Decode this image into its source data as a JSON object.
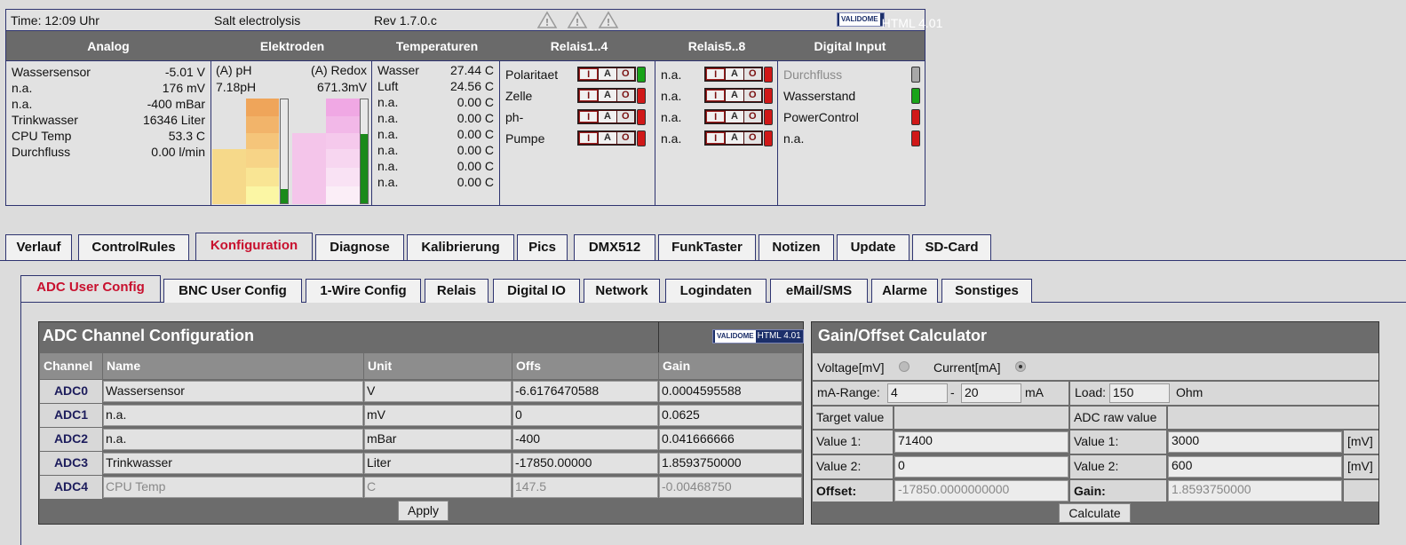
{
  "status": {
    "time": "Time: 12:09 Uhr",
    "title": "Salt electrolysis",
    "rev": "Rev 1.7.0.c",
    "validator": {
      "badge": "VALIDOME",
      "label": "HTML 4.01"
    },
    "headers": [
      "Analog",
      "Elektroden",
      "Temperaturen",
      "Relais1..4",
      "Relais5..8",
      "Digital Input"
    ],
    "analog": [
      {
        "name": "Wassersensor",
        "value": "-5.01 V"
      },
      {
        "name": "n.a.",
        "value": "176 mV"
      },
      {
        "name": "n.a.",
        "value": "-400 mBar"
      },
      {
        "name": "Trinkwasser",
        "value": "16346 Liter"
      },
      {
        "name": "CPU Temp",
        "value": "53.3 C"
      },
      {
        "name": "Durchfluss",
        "value": "0.00 l/min"
      }
    ],
    "electrodes": {
      "ph_label": "(A) pH",
      "redox_label": "(A) Redox",
      "ph_value": "7.18pH",
      "redox_value": "671.3mV",
      "ph_level": 0.14,
      "redox_level": 0.67
    },
    "temperatures": [
      {
        "name": "Wasser",
        "value": "27.44 C"
      },
      {
        "name": "Luft",
        "value": "24.56 C"
      },
      {
        "name": "n.a.",
        "value": "0.00 C"
      },
      {
        "name": "n.a.",
        "value": "0.00 C"
      },
      {
        "name": "n.a.",
        "value": "0.00 C"
      },
      {
        "name": "n.a.",
        "value": "0.00 C"
      },
      {
        "name": "n.a.",
        "value": "0.00 C"
      },
      {
        "name": "n.a.",
        "value": "0.00 C"
      }
    ],
    "relais1": [
      {
        "name": "Polaritaet",
        "state": "green"
      },
      {
        "name": "Zelle",
        "state": "red"
      },
      {
        "name": "ph-",
        "state": "red"
      },
      {
        "name": "Pumpe",
        "state": "red"
      }
    ],
    "relais2": [
      {
        "name": "n.a.",
        "state": "red"
      },
      {
        "name": "n.a.",
        "state": "red"
      },
      {
        "name": "n.a.",
        "state": "red"
      },
      {
        "name": "n.a.",
        "state": "red"
      }
    ],
    "relay_buttons": {
      "i": "I",
      "a": "A",
      "o": "O"
    },
    "digital": [
      {
        "name": "Durchfluss",
        "state": "grey"
      },
      {
        "name": "Wasserstand",
        "state": "green"
      },
      {
        "name": "PowerControl",
        "state": "red"
      },
      {
        "name": "n.a.",
        "state": "red"
      }
    ],
    "colors": {
      "border": "#2e3470",
      "header": "#6a6a6a",
      "active_tab": "#c8102e"
    }
  },
  "tabs": [
    "Verlauf",
    "ControlRules",
    "Konfiguration",
    "Diagnose",
    "Kalibrierung",
    "Pics",
    "DMX512",
    "FunkTaster",
    "Notizen",
    "Update",
    "SD-Card"
  ],
  "active_tab": "Konfiguration",
  "subtabs": [
    "ADC User Config",
    "BNC User Config",
    "1-Wire Config",
    "Relais",
    "Digital IO",
    "Network",
    "Logindaten",
    "eMail/SMS",
    "Alarme",
    "Sonstiges"
  ],
  "active_subtab": "ADC User Config",
  "adc": {
    "title": "ADC Channel Configuration",
    "columns": [
      "Channel",
      "Name",
      "Unit",
      "Offs",
      "Gain"
    ],
    "rows": [
      {
        "channel": "ADC0",
        "name": "Wassersensor",
        "unit": "V",
        "offs": "-6.6176470588",
        "gain": "0.0004595588"
      },
      {
        "channel": "ADC1",
        "name": "n.a.",
        "unit": "mV",
        "offs": "0",
        "gain": "0.0625"
      },
      {
        "channel": "ADC2",
        "name": "n.a.",
        "unit": "mBar",
        "offs": "-400",
        "gain": "0.041666666"
      },
      {
        "channel": "ADC3",
        "name": "Trinkwasser",
        "unit": "Liter",
        "offs": "-17850.00000",
        "gain": "1.8593750000"
      },
      {
        "channel": "ADC4",
        "name": "CPU Temp",
        "unit": "C",
        "offs": "147.5",
        "gain": "-0.00468750"
      }
    ],
    "apply_label": "Apply"
  },
  "calc": {
    "title": "Gain/Offset Calculator",
    "voltage_label": "Voltage[mV]",
    "current_label": "Current[mA]",
    "ma_range_label": "mA-Range:",
    "ma_from": "4",
    "dash": "-",
    "ma_to": "20",
    "ma_unit": "mA",
    "load_label": "Load:",
    "load_value": "150",
    "load_unit": "Ohm",
    "target_label": "Target value",
    "raw_label": "ADC raw value",
    "value1_label": "Value 1:",
    "value2_label": "Value 2:",
    "target1": "71400",
    "target2": "0",
    "raw1": "3000",
    "raw2": "600",
    "raw_unit": "[mV]",
    "offset_label": "Offset:",
    "offset_value": "-17850.0000000000",
    "gain_label": "Gain:",
    "gain_value": "1.8593750000",
    "calculate_label": "Calculate"
  }
}
